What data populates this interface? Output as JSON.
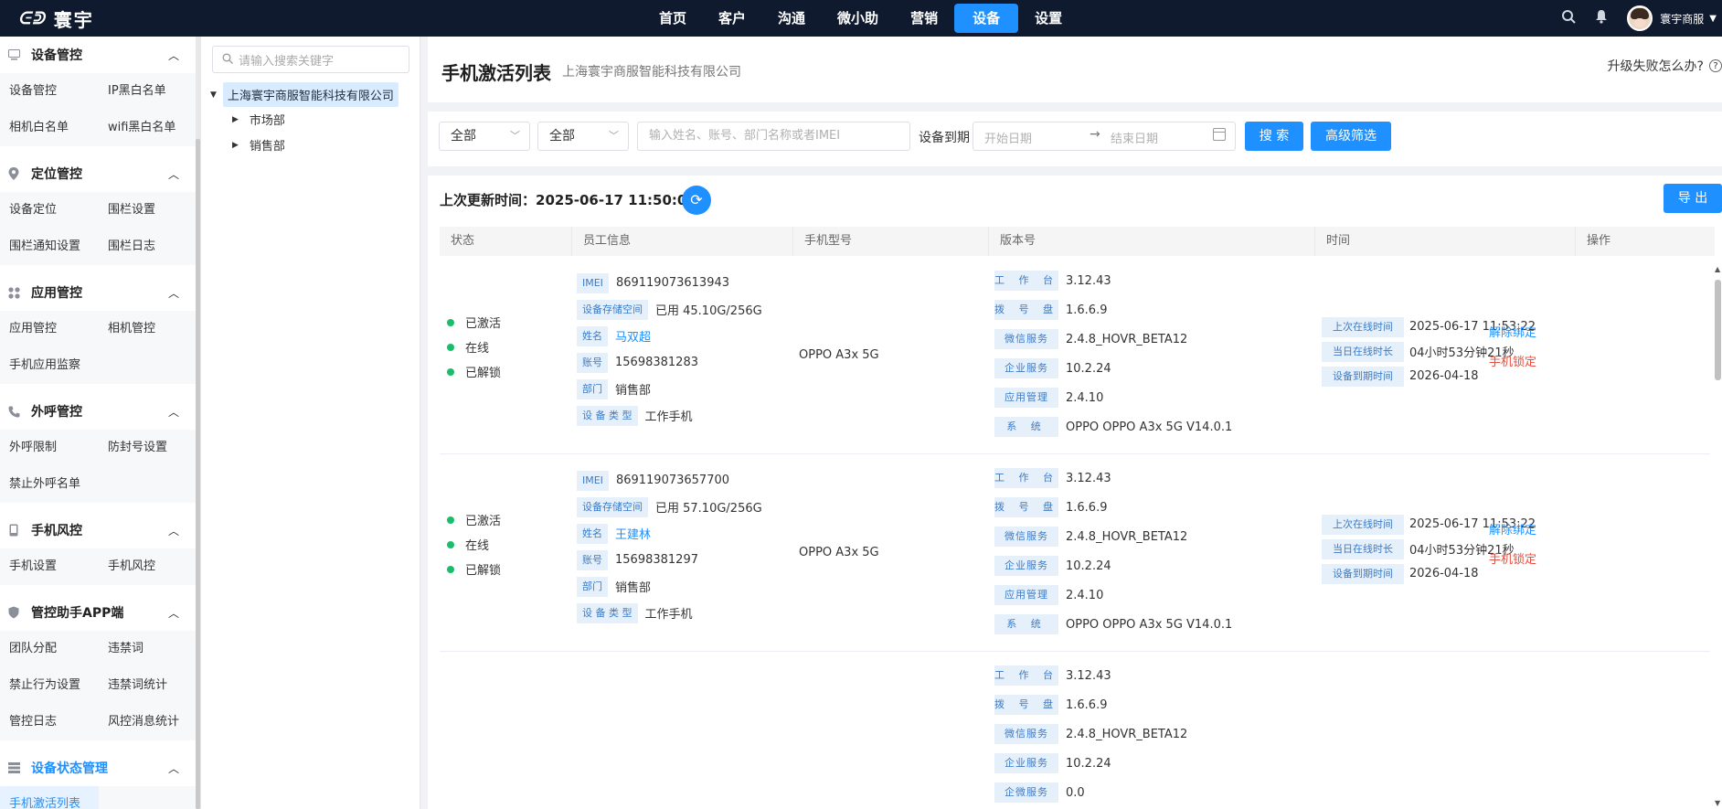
{
  "app": {
    "logo_mark": "ᕮᕲ",
    "logo_text": "寰宇",
    "user_name": "寰宇商服"
  },
  "topnav": [
    "首页",
    "客户",
    "沟通",
    "微小助",
    "营销",
    "设备",
    "设置"
  ],
  "topnav_active": 5,
  "sidemenu": [
    {
      "title": "设备管控",
      "icon": "device-icon",
      "items": [
        "设备管控",
        "IP黑白名单",
        "相机白名单",
        "wifi黑白名单"
      ]
    },
    {
      "title": "定位管控",
      "icon": "location-icon",
      "items": [
        "设备定位",
        "围栏设置",
        "围栏通知设置",
        "围栏日志"
      ]
    },
    {
      "title": "应用管控",
      "icon": "apps-icon",
      "items": [
        "应用管控",
        "相机管控",
        "手机应用监察"
      ]
    },
    {
      "title": "外呼管控",
      "icon": "phone-icon",
      "items": [
        "外呼限制",
        "防封号设置",
        "禁止外呼名单"
      ]
    },
    {
      "title": "手机风控",
      "icon": "mobile-icon",
      "items": [
        "手机设置",
        "手机风控"
      ]
    },
    {
      "title": "管控助手APP端",
      "icon": "shield-icon",
      "items": [
        "团队分配",
        "违禁词",
        "禁止行为设置",
        "违禁词统计",
        "管控日志",
        "风控消息统计"
      ]
    },
    {
      "title": "设备状态管理",
      "icon": "list-icon",
      "items": [
        "手机激活列表"
      ]
    }
  ],
  "tree": {
    "search_placeholder": "请输入搜索关键字",
    "root": "上海寰宇商服智能科技有限公司",
    "children": [
      "市场部",
      "销售部"
    ]
  },
  "page": {
    "title": "手机激活列表",
    "subtitle": "上海寰宇商服智能科技有限公司",
    "help": "升级失败怎么办?",
    "help_icon": "?"
  },
  "filters": {
    "select1": "全部",
    "select2": "全部",
    "search_placeholder": "输入姓名、账号、部门名称或者IMEI",
    "expiry_label": "设备到期",
    "start_placeholder": "开始日期",
    "end_placeholder": "结束日期",
    "search_btn": "搜 索",
    "advanced_btn": "高级筛选"
  },
  "list": {
    "last_update_label": "上次更新时间：",
    "last_update_value": "2025-06-17 11:50:09",
    "export_btn": "导 出",
    "columns": [
      "状态",
      "员工信息",
      "手机型号",
      "版本号",
      "时间",
      "操作"
    ],
    "emp_labels": {
      "imei": "IMEI",
      "storage": "设备存储空间",
      "name": "姓名",
      "account": "账号",
      "dept": "部门",
      "type": "设 备 类 型"
    },
    "ver_labels": [
      "工 作 台",
      "拨 号 盘",
      "微信服务",
      "企业服务",
      "应用管理",
      "系 统"
    ],
    "ver_labels_row3": [
      "工 作 台",
      "拨 号 盘",
      "微信服务",
      "企业服务",
      "企微服务"
    ],
    "time_labels": [
      "上次在线时间",
      "当日在线时长",
      "设备到期时间"
    ],
    "ops": {
      "unbind": "解除绑定",
      "lock": "手机锁定"
    },
    "rows": [
      {
        "status": [
          "已激活",
          "在线",
          "已解锁"
        ],
        "imei": "869119073613943",
        "storage": "已用 45.10G/256G",
        "name": "马双超",
        "account": "15698381283",
        "dept": "销售部",
        "type": "工作手机",
        "model": "OPPO A3x 5G",
        "versions": [
          "3.12.43",
          "1.6.6.9",
          "2.4.8_HOVR_BETA12",
          "10.2.24",
          "2.4.10",
          "OPPO OPPO A3x 5G V14.0.1"
        ],
        "last_online": "2025-06-17 11:53:22",
        "online_duration": "04小时53分钟21秒",
        "expiry": "2026-04-18"
      },
      {
        "status": [
          "已激活",
          "在线",
          "已解锁"
        ],
        "imei": "869119073657700",
        "storage": "已用 57.10G/256G",
        "name": "王建林",
        "account": "15698381297",
        "dept": "销售部",
        "type": "工作手机",
        "model": "OPPO A3x 5G",
        "versions": [
          "3.12.43",
          "1.6.6.9",
          "2.4.8_HOVR_BETA12",
          "10.2.24",
          "2.4.10",
          "OPPO OPPO A3x 5G V14.0.1"
        ],
        "last_online": "2025-06-17 11:53:22",
        "online_duration": "04小时53分钟21秒",
        "expiry": "2026-04-18"
      },
      {
        "versions": [
          "3.12.43",
          "1.6.6.9",
          "2.4.8_HOVR_BETA12",
          "10.2.24",
          "0.0"
        ]
      }
    ]
  }
}
